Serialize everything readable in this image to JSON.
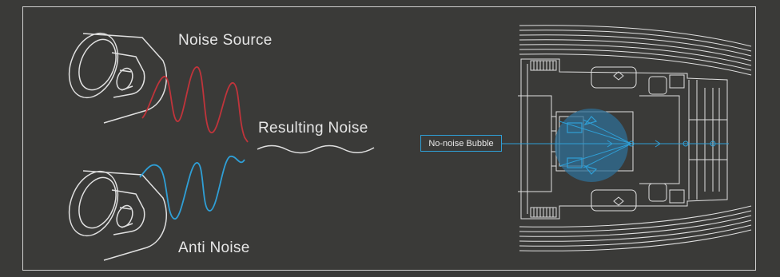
{
  "labels": {
    "noise_source": "Noise Source",
    "resulting_noise": "Resulting Noise",
    "anti_noise": "Anti Noise",
    "bubble": "No-noise Bubble"
  },
  "colors": {
    "background": "#3a3a38",
    "line": "#e0e0e0",
    "noise_wave": "#c0343b",
    "anti_wave": "#2f9fd6",
    "bubble": "#2f6f95"
  },
  "icons": [
    "speaker-icon",
    "speaker-icon",
    "yacht-cabin-plan"
  ]
}
